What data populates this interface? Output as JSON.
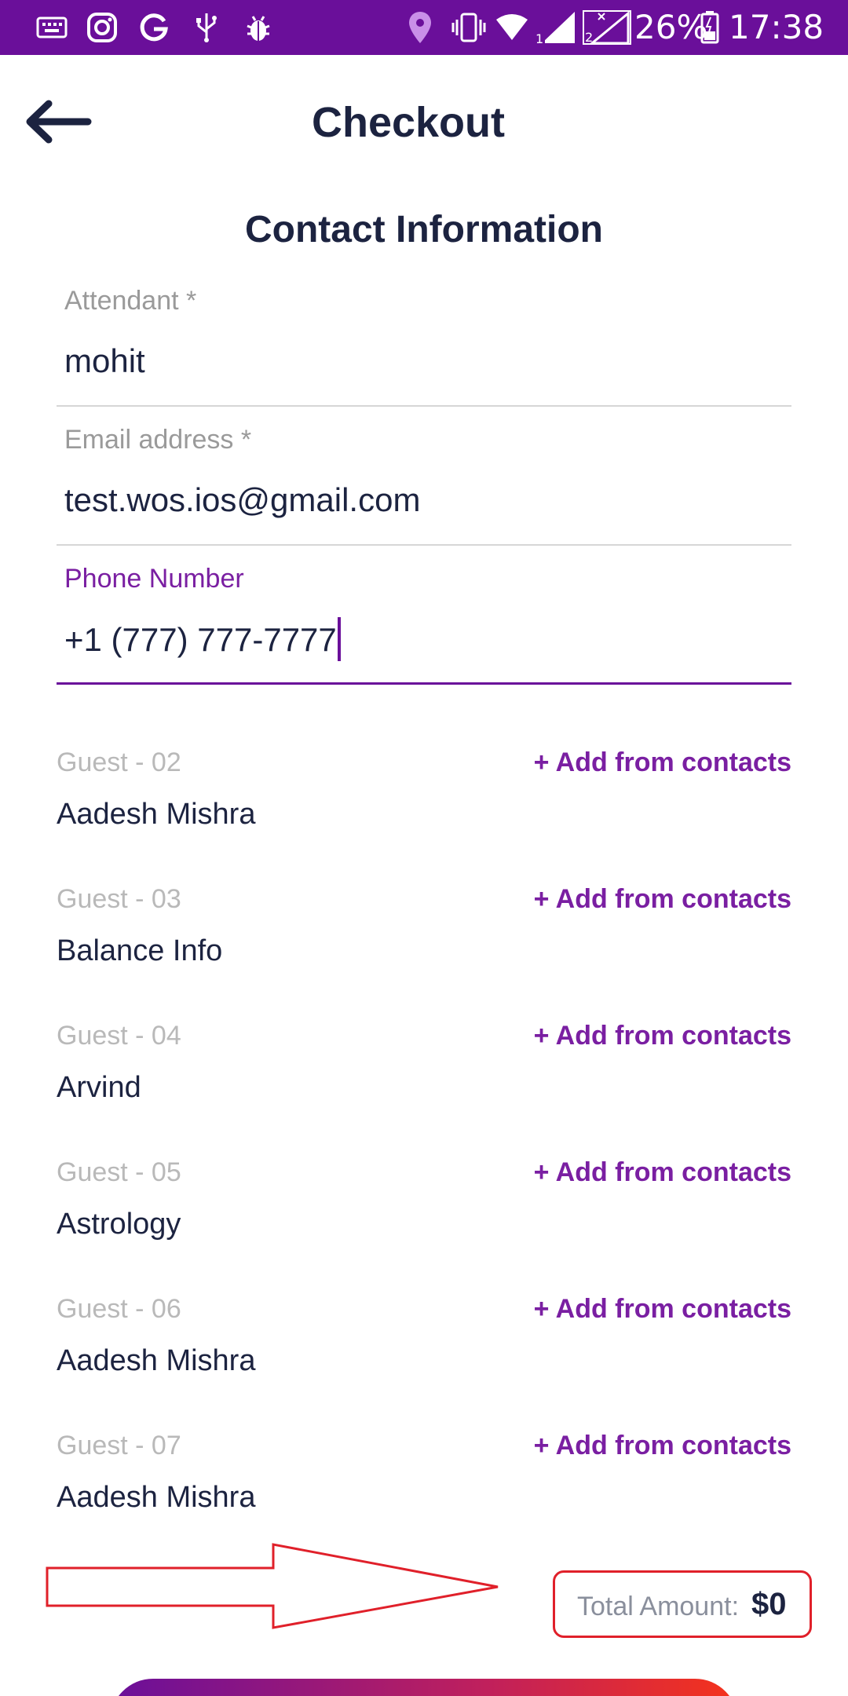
{
  "status_bar": {
    "battery": "26%",
    "time": "17:38",
    "icons": [
      "keyboard-icon",
      "instagram-icon",
      "google-icon",
      "usb-icon",
      "bug-icon",
      "location-icon",
      "vibrate-icon",
      "wifi-icon",
      "signal-sim1-icon",
      "signal-sim2-icon",
      "battery-icon"
    ]
  },
  "header": {
    "title": "Checkout",
    "back_icon": "arrow-left-icon"
  },
  "section": {
    "title": "Contact Information"
  },
  "form": {
    "attendant": {
      "label": "Attendant *",
      "value": "mohit"
    },
    "email": {
      "label": "Email address *",
      "value": "test.wos.ios@gmail.com"
    },
    "phone": {
      "label": "Phone Number",
      "value": "+1 (777) 777-7777"
    }
  },
  "guests": [
    {
      "label": "Guest - 02",
      "name": "Aadesh Mishra",
      "action": "+ Add from contacts"
    },
    {
      "label": "Guest - 03",
      "name": "Balance Info",
      "action": "+ Add from contacts"
    },
    {
      "label": "Guest - 04",
      "name": "Arvind",
      "action": "+ Add from contacts"
    },
    {
      "label": "Guest - 05",
      "name": "Astrology",
      "action": "+ Add from contacts"
    },
    {
      "label": "Guest - 06",
      "name": "Aadesh Mishra",
      "action": "+ Add from contacts"
    },
    {
      "label": "Guest - 07",
      "name": "Aadesh Mishra",
      "action": "+ Add from contacts"
    }
  ],
  "total": {
    "label": "Total Amount:",
    "value": "$0"
  },
  "colors": {
    "accent": "#6a0f9a",
    "text_dark": "#1c2340",
    "annotation": "#e0202a"
  }
}
